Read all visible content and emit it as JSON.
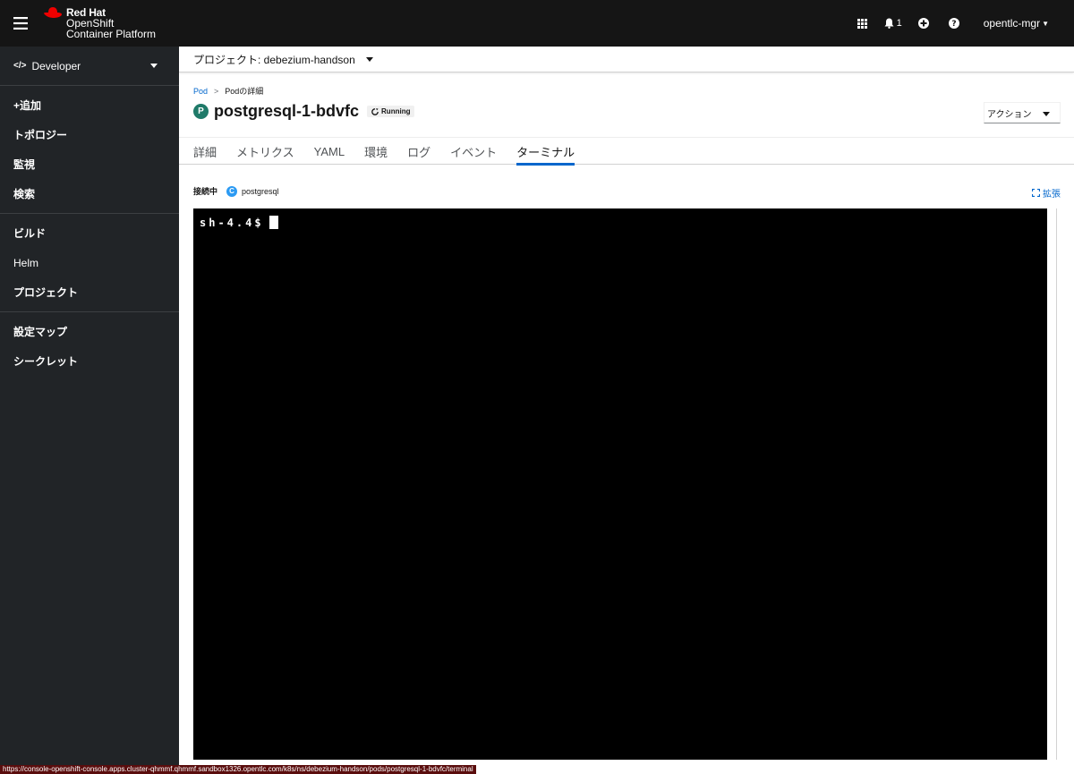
{
  "masthead": {
    "brand": {
      "line1": "Red Hat",
      "line2": "OpenShift",
      "line3": "Container Platform"
    },
    "notifications_count": "1",
    "user": "opentlc-mgr"
  },
  "sidebar": {
    "perspective": "Developer",
    "groups": [
      [
        "+追加",
        "トポロジー",
        "監視",
        "検索"
      ],
      [
        "ビルド",
        "Helm",
        "プロジェクト"
      ],
      [
        "設定マップ",
        "シークレット"
      ]
    ]
  },
  "project": {
    "label": "プロジェクト: debezium-handson"
  },
  "breadcrumb": {
    "root": "Pod",
    "sep": ">",
    "current": "Podの詳細"
  },
  "resource": {
    "badge": "P",
    "name": "postgresql-1-bdvfc",
    "status": "Running",
    "actions_label": "アクション"
  },
  "tabs": [
    "詳細",
    "メトリクス",
    "YAML",
    "環境",
    "ログ",
    "イベント",
    "ターミナル"
  ],
  "active_tab": "ターミナル",
  "connection": {
    "label": "接続中",
    "container_badge": "C",
    "container": "postgresql",
    "expand": "拡張"
  },
  "terminal": {
    "prompt": "sh-4.4$"
  },
  "status_url": "https://console-openshift-console.apps.cluster-qhmmf.qhmmf.sandbox1326.opentlc.com/k8s/ns/debezium-handson/pods/postgresql-1-bdvfc/terminal",
  "colors": {
    "masthead": "#151515",
    "sidebar": "#212427",
    "link": "#0066cc",
    "pod_badge": "#1f7a69",
    "container_badge": "#2b9af3"
  }
}
